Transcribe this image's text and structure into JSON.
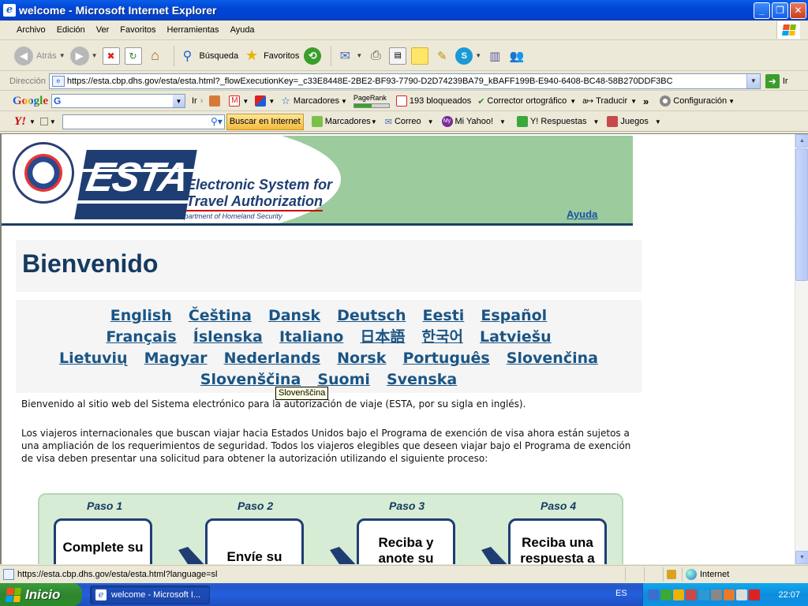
{
  "window": {
    "title": "welcome - Microsoft Internet Explorer",
    "buttons": {
      "minimize": "_",
      "maximize": "❐",
      "close": "✕"
    }
  },
  "menu": [
    "Archivo",
    "Edición",
    "Ver",
    "Favoritos",
    "Herramientas",
    "Ayuda"
  ],
  "toolbar": {
    "back": "Atrás",
    "search": "Búsqueda",
    "favorites": "Favoritos"
  },
  "address": {
    "label": "Dirección",
    "url": "https://esta.cbp.dhs.gov/esta/esta.html?_flowExecutionKey=_c33E8448E-2BE2-BF93-7790-D2D74239BA79_kBAFF199B-E940-6408-BC48-58B270DDF3BC",
    "go": "Ir"
  },
  "google_bar": {
    "logo": "Google",
    "go": "Ir",
    "bookmarks": "Marcadores",
    "pagerank": "PageRank",
    "blocked": "193 bloqueados",
    "spellcheck": "Corrector ortográfico",
    "translate": "Traducir",
    "more": "»",
    "settings": "Configuración"
  },
  "yahoo_bar": {
    "logo": "Y!",
    "search_button": "Buscar en Internet",
    "bookmarks": "Marcadores",
    "mail": "Correo",
    "my_yahoo": "Mi Yahoo!",
    "answers": "Y! Respuestas",
    "games": "Juegos"
  },
  "page": {
    "banner": {
      "logo": "ESTA",
      "line1": "Electronic System for",
      "line2": "Travel Authorization",
      "dept": "U.S. Department of Homeland Security",
      "seal_text": "U.S. DEPARTMENT OF HOMELAND SECURITY",
      "help": "Ayuda"
    },
    "heading": "Bienvenido",
    "languages": [
      "English",
      "Čeština",
      "Dansk",
      "Deutsch",
      "Eesti",
      "Español",
      "Français",
      "Íslenska",
      "Italiano",
      "日本語",
      "한국어",
      "Latviešu",
      "Lietuvių",
      "Magyar",
      "Nederlands",
      "Norsk",
      "Português",
      "Slovenčina",
      "Slovenščina",
      "Suomi",
      "Svenska"
    ],
    "tooltip": "Slovenščina",
    "intro": "Bienvenido al sitio web del Sistema electrónico para la autorización de viaje (ESTA, por su sigla en inglés).",
    "body": "Los viajeros internacionales que buscan viajar hacia Estados Unidos bajo el Programa de exención de visa ahora están sujetos a una ampliación de los requerimientos de seguridad. Todos los viajeros elegibles que deseen viajar bajo el Programa de exención de visa deben presentar una solicitud para obtener la autorización utilizando el siguiente proceso:",
    "steps": [
      {
        "label": "Paso 1",
        "text": "Complete su"
      },
      {
        "label": "Paso 2",
        "text": "Envíe su"
      },
      {
        "label": "Paso 3",
        "text": "Reciba y anote su"
      },
      {
        "label": "Paso 4",
        "text": "Reciba una respuesta a"
      }
    ]
  },
  "status": {
    "url": "https://esta.cbp.dhs.gov/esta/esta.html?language=sl",
    "zone": "Internet"
  },
  "taskbar": {
    "start": "Inicio",
    "task": "welcome - Microsoft I...",
    "lang": "ES",
    "clock": "22:07"
  }
}
